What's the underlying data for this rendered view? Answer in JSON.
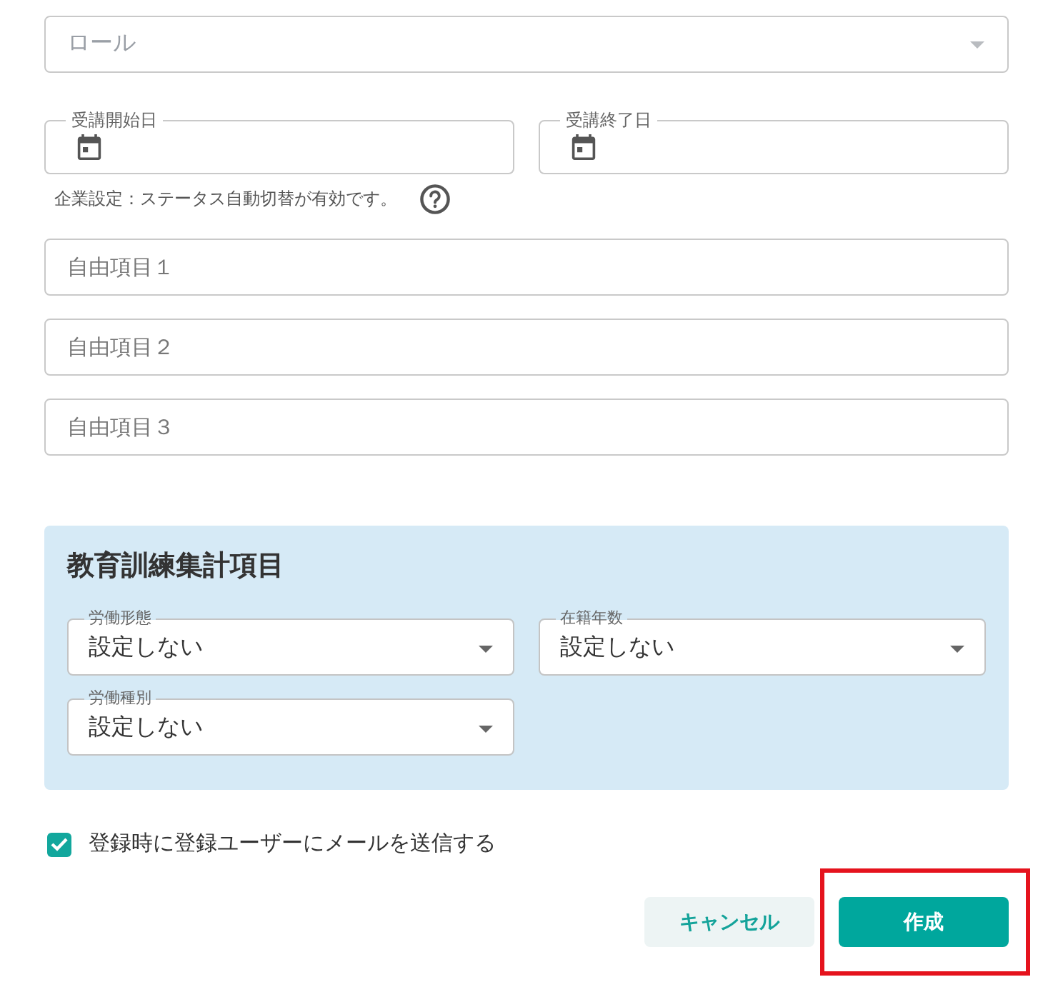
{
  "role_select": {
    "placeholder": "ロール"
  },
  "date_fields": [
    {
      "label": "受講開始日"
    },
    {
      "label": "受講終了日"
    }
  ],
  "note": {
    "text": "企業設定：ステータス自動切替が有効です。"
  },
  "free_fields": [
    {
      "placeholder": "自由項目１"
    },
    {
      "placeholder": "自由項目２"
    },
    {
      "placeholder": "自由項目３"
    }
  ],
  "training_panel": {
    "title": "教育訓練集計項目",
    "selects": [
      {
        "label": "労働形態",
        "value": "設定しない"
      },
      {
        "label": "在籍年数",
        "value": "設定しない"
      },
      {
        "label": "労働種別",
        "value": "設定しない"
      }
    ]
  },
  "mail_option": {
    "label": "登録時に登録ユーザーにメールを送信する",
    "checked": true
  },
  "buttons": [
    {
      "kind": "secondary",
      "label": "キャンセル",
      "highlighted": false
    },
    {
      "kind": "primary",
      "label": "作成",
      "highlighted": true
    }
  ]
}
